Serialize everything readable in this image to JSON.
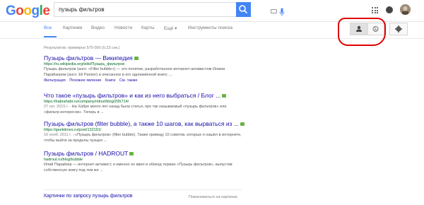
{
  "logo": {
    "letters": [
      "G",
      "o",
      "o",
      "g",
      "l",
      "e"
    ],
    "colors": [
      "#4285f4",
      "#ea4335",
      "#fbbc05",
      "#4285f4",
      "#34a853",
      "#ea4335"
    ]
  },
  "search": {
    "value": "пузырь фильтров",
    "placeholder": ""
  },
  "tabs": [
    "Все",
    "Картинки",
    "Видео",
    "Новости",
    "Карты",
    "Ещё ▾",
    "Инструменты поиска"
  ],
  "stats": "Результатов: примерно 579 000 (0,23 сек.)",
  "results": [
    {
      "title": "Пузырь фильтров — Википедия",
      "url": "https://ru.wikipedia.org/wiki/Пузырь_фильтров",
      "snippet": "Пузырь фильтров (англ. «Filter bubble») — это понятие, разработанное интернет-активистом Илаем Парайзером (англ. Eli Pariser) и описанное в его одноимённой книге; ...",
      "sublinks": [
        "Фильтрация",
        "Похожее явление",
        "Книги",
        "См. также"
      ]
    },
    {
      "title": "Что такое «пузырь фильтров» и как из него выбраться / Блог ...",
      "url": "https://habrahabr.ru/company/ridout/blog/295714/",
      "date": "27 окт. 2015 г. -",
      "snippet": "На Хабре много лет назад была статья, про так называемый «пузырь фильтров» или «фильтр интересов». Теперь в ..."
    },
    {
      "title": "Пузырь фильтров (filter bubble), а также 10 шагов, как вырваться из ...",
      "url": "https://geektimes.ru/post/132191/",
      "date": "10 нояб. 2011 г. -",
      "snippet": "«Пузырь фильтров» (filter bubble). Также приведу 10 советов, которые я нашёл в интернете, чтобы выйти за пределы пузыря ..."
    },
    {
      "title": "Пузырь фильтров / HADROUT",
      "url": "hadrout.ru/blog/bubble",
      "snippet": "Илай Парайзер — интернет-активист, и именно он ввел в обиход термин «Пузырь фильтров», выпустив собственную книгу под тем же ..."
    }
  ],
  "related": {
    "title": "Картинки по запросу пузырь фильтров",
    "right": "Пожаловаться на картинки"
  },
  "colors": {
    "accent": "#4285f4",
    "link": "#1a0dab",
    "url": "#006621",
    "annotation": "#e00000"
  }
}
